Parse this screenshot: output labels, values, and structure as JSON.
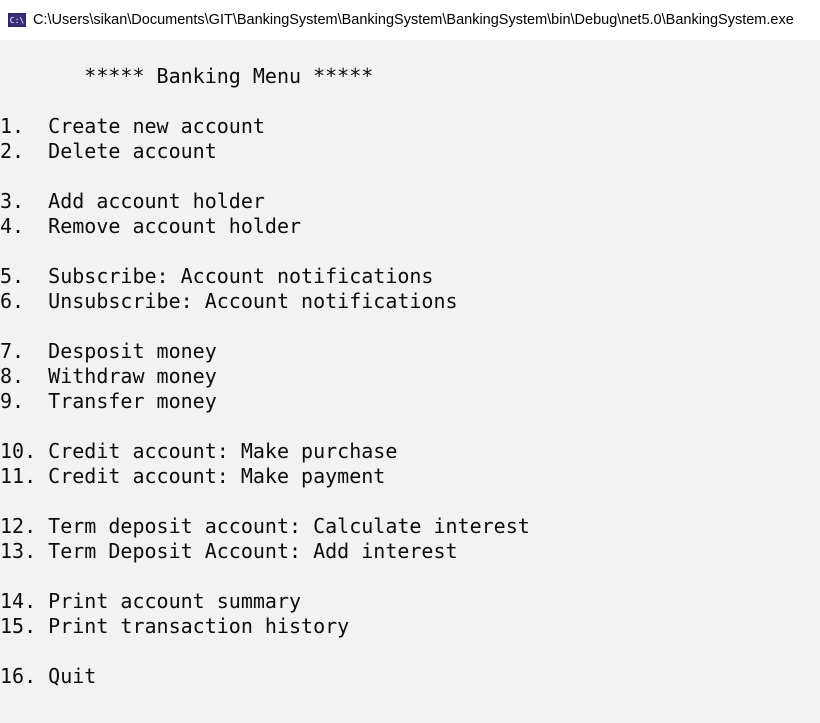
{
  "window": {
    "title": "C:\\Users\\sikan\\Documents\\GIT\\BankingSystem\\BankingSystem\\BankingSystem\\bin\\Debug\\net5.0\\BankingSystem.exe",
    "icon": "console-app-icon",
    "icon_glyph": "C:\\"
  },
  "console": {
    "menu_title": "       ***** Banking Menu *****",
    "items": [
      "1.  Create new account",
      "2.  Delete account",
      "3.  Add account holder",
      "4.  Remove account holder",
      "5.  Subscribe: Account notifications",
      "6.  Unsubscribe: Account notifications",
      "7.  Desposit money",
      "8.  Withdraw money",
      "9.  Transfer money",
      "10. Credit account: Make purchase",
      "11. Credit account: Make payment",
      "12. Term deposit account: Calculate interest",
      "13. Term Deposit Account: Add interest",
      "14. Print account summary",
      "15. Print transaction history",
      "16. Quit"
    ]
  },
  "colors": {
    "console_background": "#f2f2f2",
    "console_text": "#0c0c0c",
    "titlebar_background": "#ffffff",
    "icon_background": "#3a2e7a"
  }
}
